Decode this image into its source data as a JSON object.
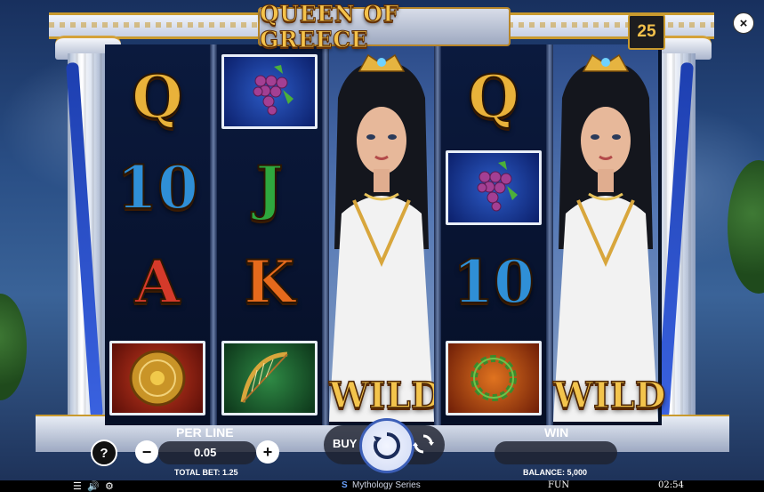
{
  "game": {
    "title": "QUEEN OF GREECE",
    "lines": "25",
    "close_label": "×"
  },
  "reels": [
    {
      "symbols": [
        "Q",
        "10",
        "A",
        "shield"
      ]
    },
    {
      "symbols": [
        "grapes",
        "J",
        "K",
        "harp"
      ]
    },
    {
      "symbols": [
        "queen-wild"
      ],
      "wild_label": "WILD"
    },
    {
      "symbols": [
        "Q",
        "grapes",
        "10",
        "laurel"
      ]
    },
    {
      "symbols": [
        "queen-wild"
      ],
      "wild_label": "WILD"
    }
  ],
  "controls": {
    "help_label": "?",
    "per_line_label": "PER LINE",
    "per_line_value": "0.05",
    "minus_label": "−",
    "plus_label": "+",
    "total_bet_label": "TOTAL BET: 1.25",
    "buy_label": "BUY",
    "win_label": "WIN",
    "win_value": "",
    "balance_label": "BALANCE: 5,000"
  },
  "status_bar": {
    "series": "Mythology Series",
    "mode": "FUN",
    "time": "02:54"
  },
  "icons": [
    "menu-icon",
    "sound-icon",
    "settings-icon",
    "spin-icon",
    "autoplay-icon",
    "close-icon"
  ],
  "colors": {
    "gold": "#e9b23a",
    "reel_bg": "#061127",
    "spin_ring": "#3c5fb8"
  }
}
